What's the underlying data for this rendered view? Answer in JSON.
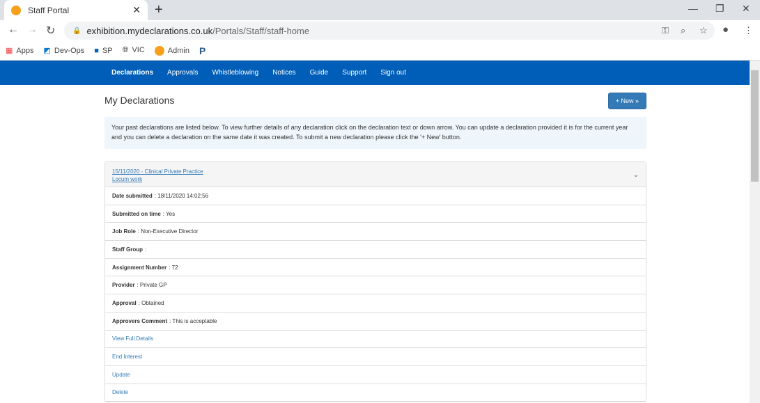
{
  "browser": {
    "tab_title": "Staff Portal",
    "url_host": "exhibition.mydeclarations.co.uk",
    "url_path": "/Portals/Staff/staff-home",
    "bookmarks": [
      {
        "label": "Apps",
        "icon": "apps-grid-icon"
      },
      {
        "label": "Dev-Ops",
        "icon": "azure-devops-icon"
      },
      {
        "label": "SP",
        "icon": "sharepoint-icon"
      },
      {
        "label": "VIC",
        "icon": "globe-icon"
      },
      {
        "label": "Admin",
        "icon": "orange-circle-icon"
      },
      {
        "label": "P",
        "icon": "p-icon"
      }
    ]
  },
  "nav": {
    "items": [
      "Declarations",
      "Approvals",
      "Whistleblowing",
      "Notices",
      "Guide",
      "Support",
      "Sign out"
    ]
  },
  "page": {
    "title": "My Declarations",
    "new_button": "+ New »",
    "info": "Your past declarations are listed below. To view further details of any declaration click on the declaration text or down arrow. You can update a declaration provided it is for the current year and you can delete a declaration on the same date it was created. To submit a new declaration please click the '+ New' button."
  },
  "declaration": {
    "heading": "15/11/2020 - Clinical Private Practice",
    "subheading": "Locum work",
    "fields": [
      {
        "label": "Date submitted",
        "value": ": 18/11/2020 14:02:56"
      },
      {
        "label": "Submitted on time",
        "value": ": Yes"
      },
      {
        "label": "Job Role",
        "value": ": Non-Executive Director"
      },
      {
        "label": "Staff Group",
        "value": ":"
      },
      {
        "label": "Assignment Number",
        "value": ": 72"
      },
      {
        "label": "Provider",
        "value": ": Private GP"
      },
      {
        "label": "Approval",
        "value": ": Obtained"
      },
      {
        "label": "Approvers Comment",
        "value": ": This is acceptable"
      }
    ],
    "actions": [
      "View Full Details",
      "End Interest",
      "Update",
      "Delete"
    ]
  },
  "colors": {
    "nav": "#005eb8",
    "button": "#337ab7",
    "info_bg": "#eef6fc"
  }
}
